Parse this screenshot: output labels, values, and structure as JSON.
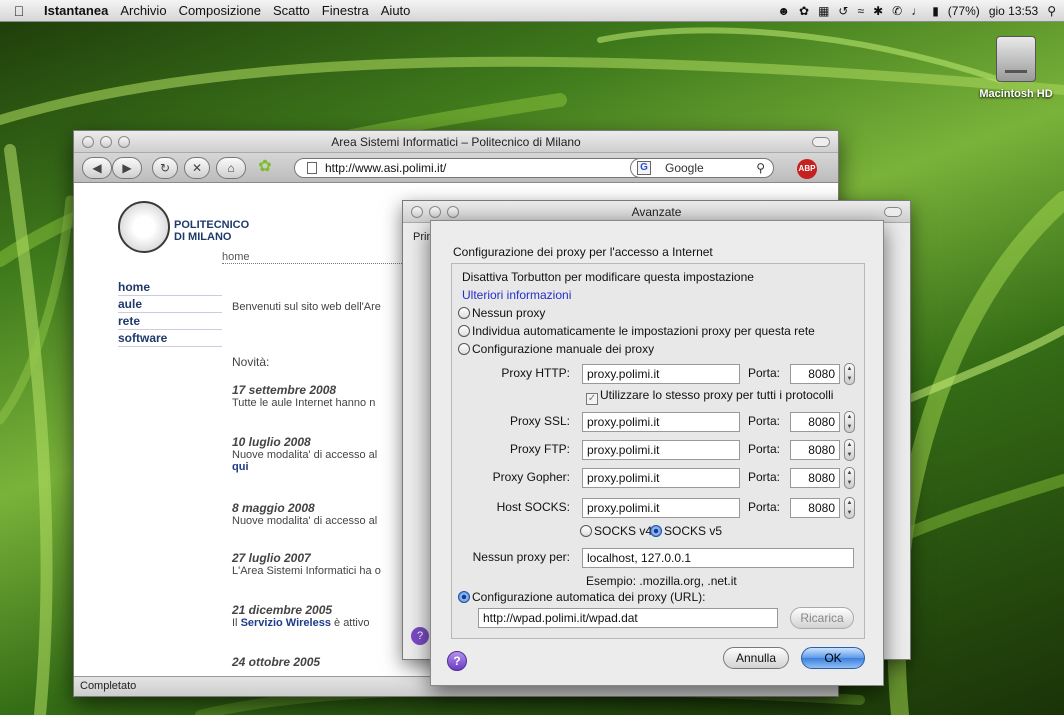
{
  "menubar": {
    "app_name": "Istantanea",
    "items": [
      "Archivio",
      "Composizione",
      "Scatto",
      "Finestra",
      "Aiuto"
    ],
    "battery": "(77%)",
    "clock": "gio 13:53"
  },
  "desktop": {
    "disk_label": "Macintosh HD"
  },
  "browser": {
    "title": "Area Sistemi Informatici – Politecnico di Milano",
    "url": "http://www.asi.polimi.it/",
    "search_engine": "Google",
    "status": "Completato",
    "page": {
      "logo_line1": "POLITECNICO",
      "logo_line2": "DI MILANO",
      "crumb": "home",
      "nav": [
        "home",
        "aule",
        "rete",
        "software"
      ],
      "welcome": "Benvenuti sul sito web dell'Are",
      "news_heading": "Novità:",
      "news": [
        {
          "date": "17 settembre 2008",
          "text": "Tutte le aule Internet hanno n"
        },
        {
          "date": "10 luglio 2008",
          "text": "Nuove modalita' di accesso al",
          "link": "qui"
        },
        {
          "date": "8 maggio 2008",
          "text": "Nuove modalita' di accesso al"
        },
        {
          "date": "27 luglio 2007",
          "text": "L'Area Sistemi Informatici ha o"
        },
        {
          "date": "21 dicembre 2005",
          "text_prefix": "Il",
          "link": "Servizio Wireless",
          "text_suffix": "è attivo"
        },
        {
          "date": "24 ottobre 2005",
          "text": ""
        }
      ]
    }
  },
  "avanzate": {
    "title": "Avanzate",
    "tab_fragment": "Prim"
  },
  "proxy_sheet": {
    "heading": "Configurazione dei proxy per l'accesso a Internet",
    "torbutton_note": "Disattiva Torbutton per modificare questa impostazione",
    "more_info": "Ulteriori informazioni",
    "radio_no_proxy": "Nessun proxy",
    "radio_auto_detect": "Individua automaticamente le impostazioni proxy per questa rete",
    "radio_manual": "Configurazione manuale dei proxy",
    "port_label": "Porta:",
    "rows": [
      {
        "label": "Proxy HTTP:",
        "host": "proxy.polimi.it",
        "port": "8080"
      },
      {
        "label": "Proxy SSL:",
        "host": "proxy.polimi.it",
        "port": "8080"
      },
      {
        "label": "Proxy FTP:",
        "host": "proxy.polimi.it",
        "port": "8080"
      },
      {
        "label": "Proxy Gopher:",
        "host": "proxy.polimi.it",
        "port": "8080"
      },
      {
        "label": "Host SOCKS:",
        "host": "proxy.polimi.it",
        "port": "8080"
      }
    ],
    "same_proxy": "Utilizzare lo stesso proxy per tutti i protocolli",
    "socks_v4": "SOCKS v4",
    "socks_v5": "SOCKS v5",
    "no_proxy_label": "Nessun proxy per:",
    "no_proxy_value": "localhost, 127.0.0.1",
    "example": "Esempio: .mozilla.org, .net.it",
    "radio_auto_url": "Configurazione automatica dei proxy (URL):",
    "auto_url_value": "http://wpad.polimi.it/wpad.dat",
    "reload": "Ricarica",
    "cancel": "Annulla",
    "ok": "OK"
  }
}
